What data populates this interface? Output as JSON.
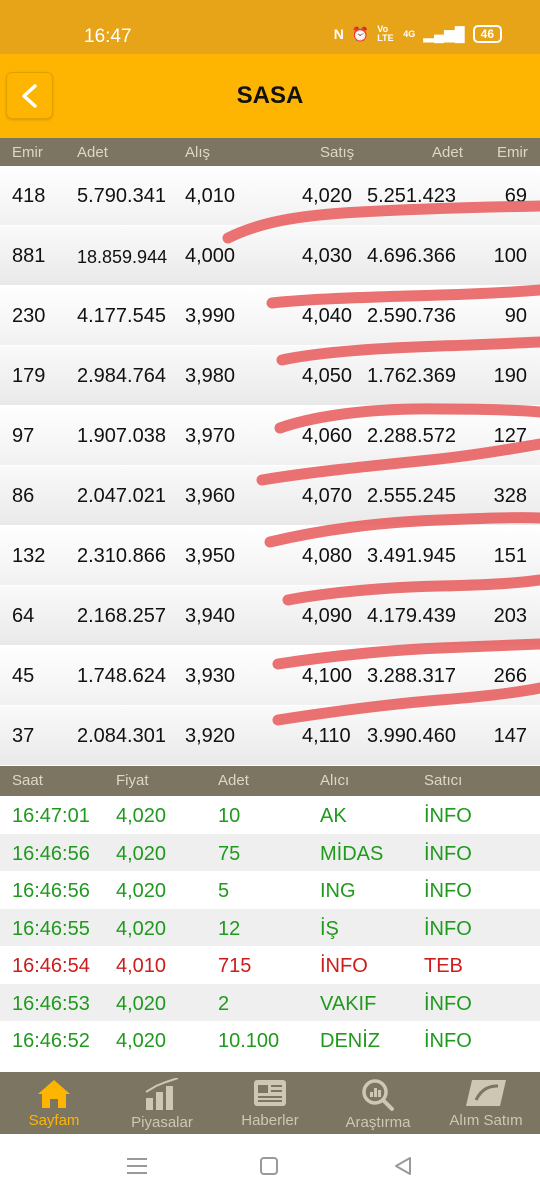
{
  "status_bar": {
    "time": "16:47",
    "network": "4G",
    "volte": "Vo LTE",
    "battery": "46"
  },
  "app_bar": {
    "title": "SASA"
  },
  "order_book": {
    "headers": {
      "emir_bid": "Emir",
      "adet_bid": "Adet",
      "alis": "Alış",
      "satis": "Satış",
      "adet_ask": "Adet",
      "emir_ask": "Emir"
    },
    "rows": [
      {
        "bid_count": "418",
        "bid_qty": "5.790.341",
        "bid_price": "4,010",
        "ask_price": "4,020",
        "ask_qty": "5.251.423",
        "ask_count": "69"
      },
      {
        "bid_count": "881",
        "bid_qty": "18.859.944",
        "bid_price": "4,000",
        "ask_price": "4,030",
        "ask_qty": "4.696.366",
        "ask_count": "100"
      },
      {
        "bid_count": "230",
        "bid_qty": "4.177.545",
        "bid_price": "3,990",
        "ask_price": "4,040",
        "ask_qty": "2.590.736",
        "ask_count": "90"
      },
      {
        "bid_count": "179",
        "bid_qty": "2.984.764",
        "bid_price": "3,980",
        "ask_price": "4,050",
        "ask_qty": "1.762.369",
        "ask_count": "190"
      },
      {
        "bid_count": "97",
        "bid_qty": "1.907.038",
        "bid_price": "3,970",
        "ask_price": "4,060",
        "ask_qty": "2.288.572",
        "ask_count": "127"
      },
      {
        "bid_count": "86",
        "bid_qty": "2.047.021",
        "bid_price": "3,960",
        "ask_price": "4,070",
        "ask_qty": "2.555.245",
        "ask_count": "328"
      },
      {
        "bid_count": "132",
        "bid_qty": "2.310.866",
        "bid_price": "3,950",
        "ask_price": "4,080",
        "ask_qty": "3.491.945",
        "ask_count": "151"
      },
      {
        "bid_count": "64",
        "bid_qty": "2.168.257",
        "bid_price": "3,940",
        "ask_price": "4,090",
        "ask_qty": "4.179.439",
        "ask_count": "203"
      },
      {
        "bid_count": "45",
        "bid_qty": "1.748.624",
        "bid_price": "3,930",
        "ask_price": "4,100",
        "ask_qty": "3.288.317",
        "ask_count": "266"
      },
      {
        "bid_count": "37",
        "bid_qty": "2.084.301",
        "bid_price": "3,920",
        "ask_price": "4,110",
        "ask_qty": "3.990.460",
        "ask_count": "147"
      }
    ]
  },
  "trades": {
    "headers": {
      "saat": "Saat",
      "fiyat": "Fiyat",
      "adet": "Adet",
      "alici": "Alıcı",
      "satici": "Satıcı"
    },
    "rows": [
      {
        "time": "16:47:01",
        "price": "4,020",
        "qty": "10",
        "buyer": "AK",
        "seller": "İNFO",
        "color": "green"
      },
      {
        "time": "16:46:56",
        "price": "4,020",
        "qty": "75",
        "buyer": "MİDAS",
        "seller": "İNFO",
        "color": "green"
      },
      {
        "time": "16:46:56",
        "price": "4,020",
        "qty": "5",
        "buyer": "ING",
        "seller": "İNFO",
        "color": "green"
      },
      {
        "time": "16:46:55",
        "price": "4,020",
        "qty": "12",
        "buyer": "İŞ",
        "seller": "İNFO",
        "color": "green"
      },
      {
        "time": "16:46:54",
        "price": "4,010",
        "qty": "715",
        "buyer": "İNFO",
        "seller": "TEB",
        "color": "red"
      },
      {
        "time": "16:46:53",
        "price": "4,020",
        "qty": "2",
        "buyer": "VAKIF",
        "seller": "İNFO",
        "color": "green"
      },
      {
        "time": "16:46:52",
        "price": "4,020",
        "qty": "10.100",
        "buyer": "DENİZ",
        "seller": "İNFO",
        "color": "green"
      }
    ]
  },
  "bottom_nav": {
    "items": [
      {
        "label": "Sayfam",
        "icon": "home-icon",
        "active": true
      },
      {
        "label": "Piyasalar",
        "icon": "bar-chart-icon",
        "active": false
      },
      {
        "label": "Haberler",
        "icon": "news-icon",
        "active": false
      },
      {
        "label": "Araştırma",
        "icon": "research-icon",
        "active": false
      },
      {
        "label": "Alım Satım",
        "icon": "trade-icon",
        "active": false
      }
    ]
  },
  "colors": {
    "accent": "#fdb502",
    "header_bg": "#7b7562",
    "up": "#1f9a1d",
    "down": "#cc1c1c",
    "scribble": "#e85a5a"
  }
}
